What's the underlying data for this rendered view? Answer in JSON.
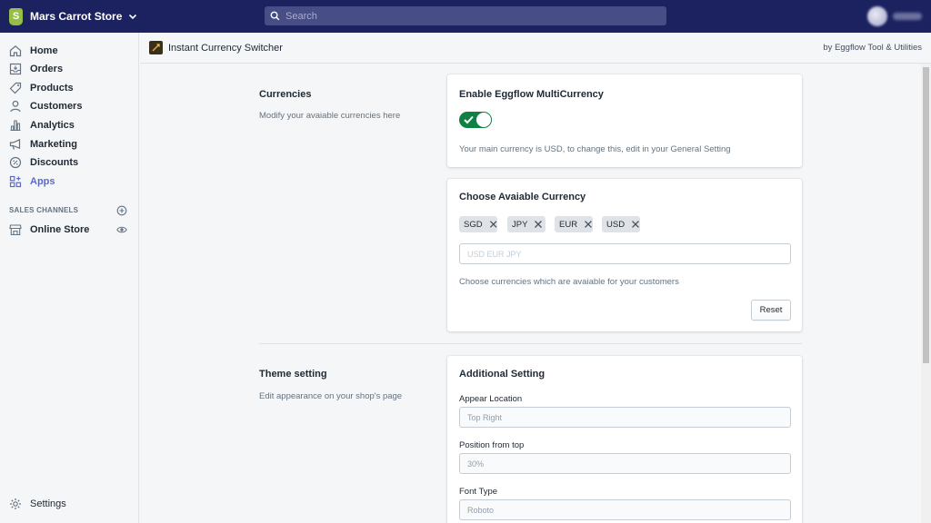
{
  "topbar": {
    "store_name": "Mars Carrot Store",
    "search_placeholder": "Search"
  },
  "sidebar": {
    "items": [
      {
        "label": "Home",
        "icon": "home-icon"
      },
      {
        "label": "Orders",
        "icon": "orders-icon"
      },
      {
        "label": "Products",
        "icon": "tag-icon"
      },
      {
        "label": "Customers",
        "icon": "person-icon"
      },
      {
        "label": "Analytics",
        "icon": "bar-chart-icon"
      },
      {
        "label": "Marketing",
        "icon": "megaphone-icon"
      },
      {
        "label": "Discounts",
        "icon": "discount-icon"
      },
      {
        "label": "Apps",
        "icon": "apps-icon",
        "active": true
      }
    ],
    "sales_channels_title": "SALES CHANNELS",
    "channel": {
      "label": "Online Store"
    },
    "settings_label": "Settings"
  },
  "app": {
    "title": "Instant Currency Switcher",
    "by": "by Eggflow Tool & Utilities"
  },
  "currencies_section": {
    "title": "Currencies",
    "description": "Modify your avaiable currencies here"
  },
  "enable_card": {
    "title": "Enable Eggflow MultiCurrency",
    "toggle_on": true,
    "note": "Your main currency is USD, to change this, edit in your General Setting"
  },
  "choose_card": {
    "title": "Choose Avaiable Currency",
    "tags": [
      "SGD",
      "JPY",
      "EUR",
      "USD"
    ],
    "input_placeholder": "USD EUR JPY",
    "help": "Choose currencies which are avaiable for your customers",
    "reset_label": "Reset"
  },
  "theme_section": {
    "title": "Theme setting",
    "description": "Edit appearance on your shop's page"
  },
  "additional_card": {
    "title": "Additional Setting",
    "fields": [
      {
        "label": "Appear Location",
        "value": "Top Right"
      },
      {
        "label": "Position from top",
        "value": "30%"
      },
      {
        "label": "Font Type",
        "value": "Roboto"
      }
    ]
  },
  "colors": {
    "topbar": "#1c2260",
    "accent": "#5c6ac4",
    "toggle_on": "#108043"
  }
}
